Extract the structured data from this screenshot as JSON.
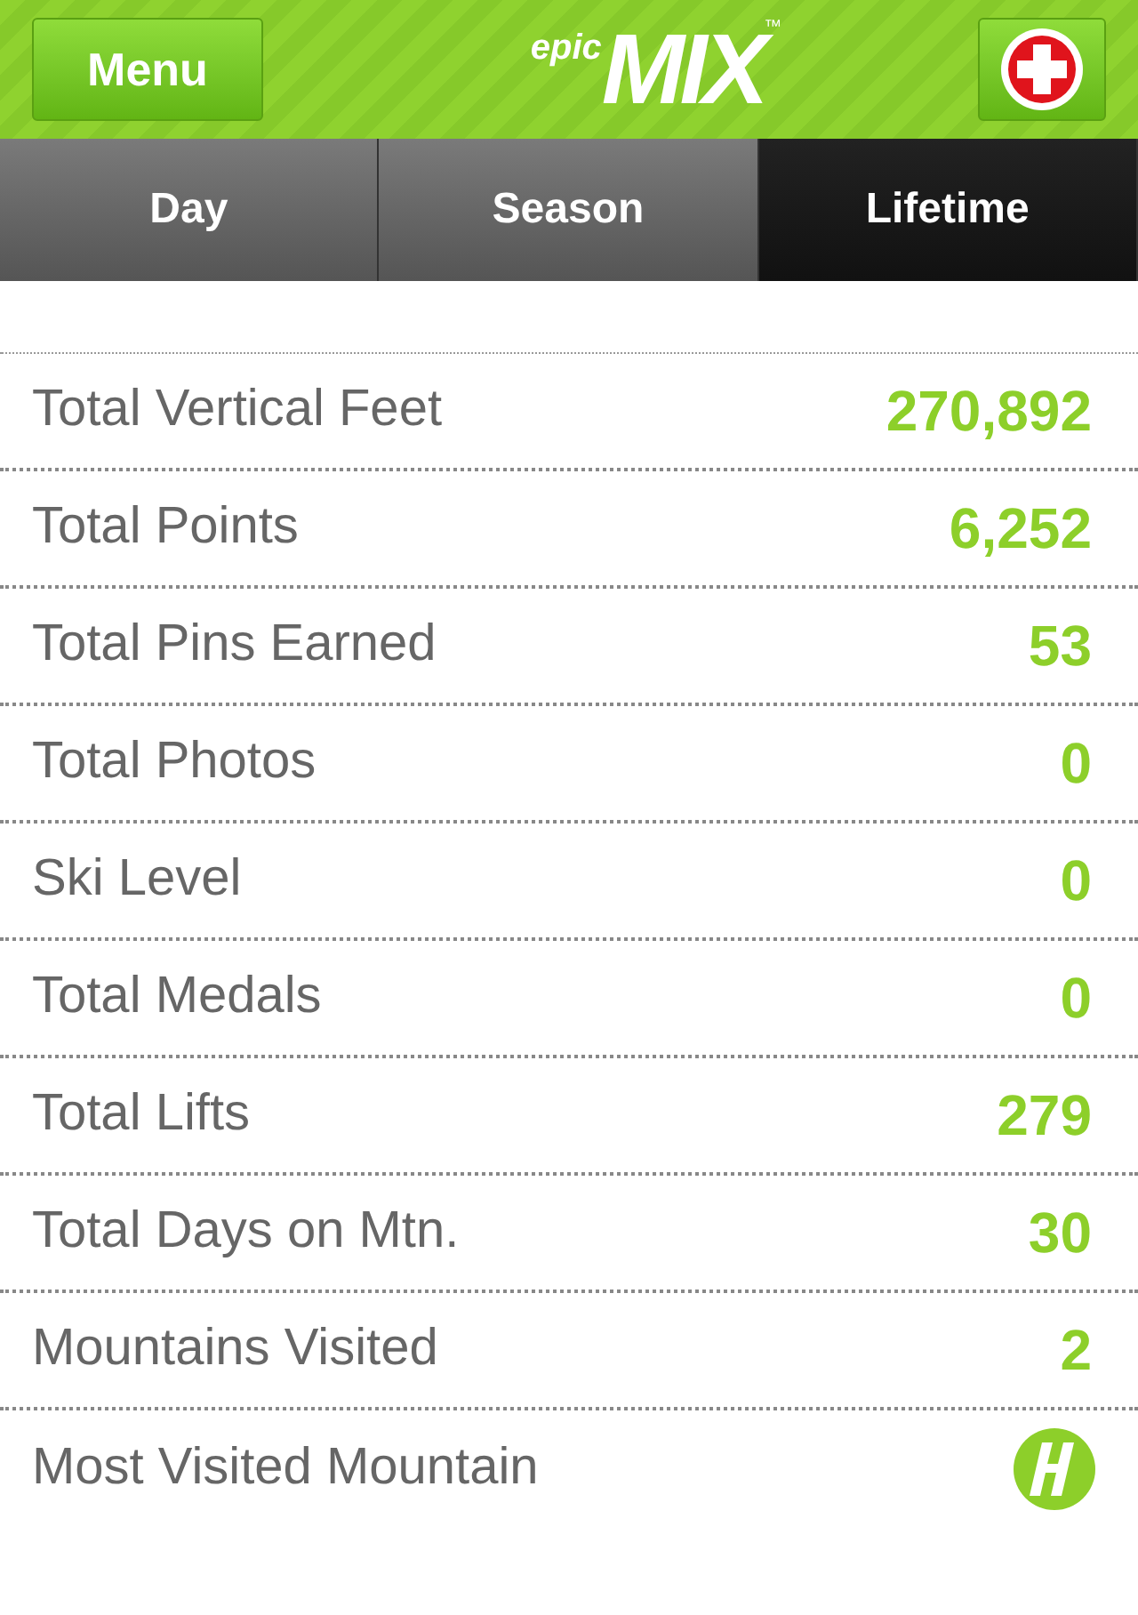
{
  "header": {
    "menu_button": "Menu",
    "logo_small": "epic",
    "logo_large": "MIX",
    "logo_mark": "™"
  },
  "tabs": [
    {
      "label": "Day",
      "selected": false
    },
    {
      "label": "Season",
      "selected": false
    },
    {
      "label": "Lifetime",
      "selected": true
    }
  ],
  "stats": [
    {
      "kind": "text",
      "label": "Total Vertical Feet",
      "value": "270,892"
    },
    {
      "kind": "text",
      "label": "Total Points",
      "value": "6,252"
    },
    {
      "kind": "text",
      "label": "Total Pins Earned",
      "value": "53"
    },
    {
      "kind": "text",
      "label": "Total Photos",
      "value": "0"
    },
    {
      "kind": "text",
      "label": "Ski Level",
      "value": "0"
    },
    {
      "kind": "text",
      "label": "Total Medals",
      "value": "0"
    },
    {
      "kind": "text",
      "label": "Total Lifts",
      "value": "279"
    },
    {
      "kind": "text",
      "label": "Total Days on Mtn.",
      "value": "30"
    },
    {
      "kind": "text",
      "label": "Mountains Visited",
      "value": "2"
    },
    {
      "kind": "icon",
      "label": "Most Visited Mountain"
    }
  ]
}
